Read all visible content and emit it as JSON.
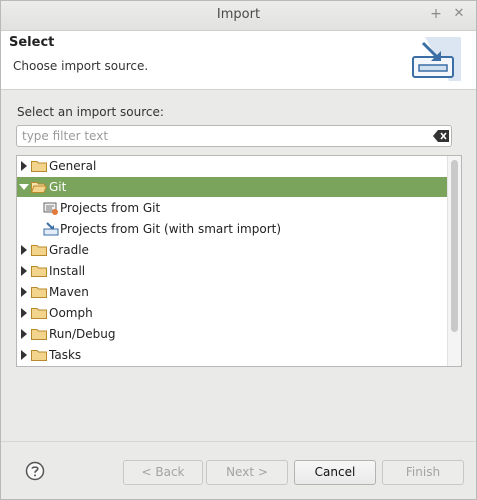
{
  "window": {
    "title": "Import",
    "maximize_glyph": "+",
    "close_glyph": "✕"
  },
  "header": {
    "title": "Select",
    "description": "Choose import source.",
    "graphic": "import-wizard-icon"
  },
  "content": {
    "label": "Select an import source:"
  },
  "filter": {
    "placeholder": "type filter text",
    "value": "",
    "clear_icon": "clear-icon"
  },
  "tree": {
    "items": [
      {
        "label": "General",
        "expanded": false,
        "selected": false
      },
      {
        "label": "Git",
        "expanded": true,
        "selected": true
      },
      {
        "label": "Projects from Git",
        "child": true,
        "icon": "git-projects-icon"
      },
      {
        "label": "Projects from Git (with smart import)",
        "child": true,
        "icon": "smart-import-icon"
      },
      {
        "label": "Gradle",
        "expanded": false,
        "selected": false
      },
      {
        "label": "Install",
        "expanded": false,
        "selected": false
      },
      {
        "label": "Maven",
        "expanded": false,
        "selected": false
      },
      {
        "label": "Oomph",
        "expanded": false,
        "selected": false
      },
      {
        "label": "Run/Debug",
        "expanded": false,
        "selected": false
      },
      {
        "label": "Tasks",
        "expanded": false,
        "selected": false
      }
    ]
  },
  "buttons": {
    "back": "< Back",
    "next": "Next >",
    "cancel": "Cancel",
    "finish": "Finish"
  },
  "colors": {
    "selection": "#7aa35c",
    "folder": "#e7b85a",
    "default_button_border": "#9cc086"
  }
}
